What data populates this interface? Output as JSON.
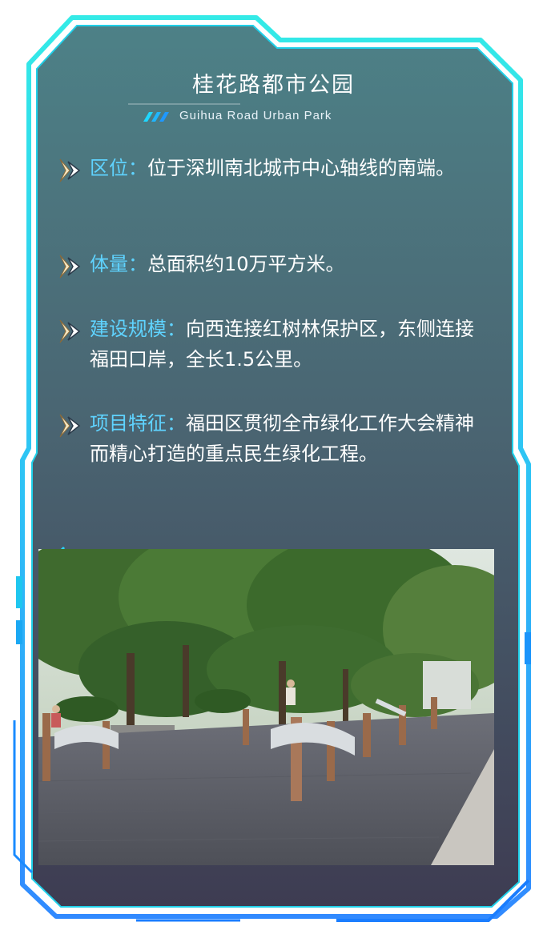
{
  "header": {
    "title": "桂花路都市公园",
    "subtitle": "Guihua Road Urban Park"
  },
  "items": [
    {
      "label": "区位：",
      "text": "位于深圳南北城市中心轴线的南端。"
    },
    {
      "label": "体量：",
      "text": "总面积约10万平方米。"
    },
    {
      "label": "建设规模：",
      "text": "向西连接红树林保护区，东侧连接福田口岸，全长1.5公里。"
    },
    {
      "label": "项目特征：",
      "text": "福田区贯彻全市绿化工作大会精神而精心打造的重点民生绿化工程。"
    }
  ],
  "photo": {
    "subject": "park fitness area with exercise equipment, trees and stone pavement"
  },
  "colors": {
    "accent_cyan": "#19e3ee",
    "accent_blue": "#1a8bff",
    "label_blue": "#5fd3ff",
    "panel_top": "#4b7e86",
    "panel_bottom": "#3f3f55"
  }
}
